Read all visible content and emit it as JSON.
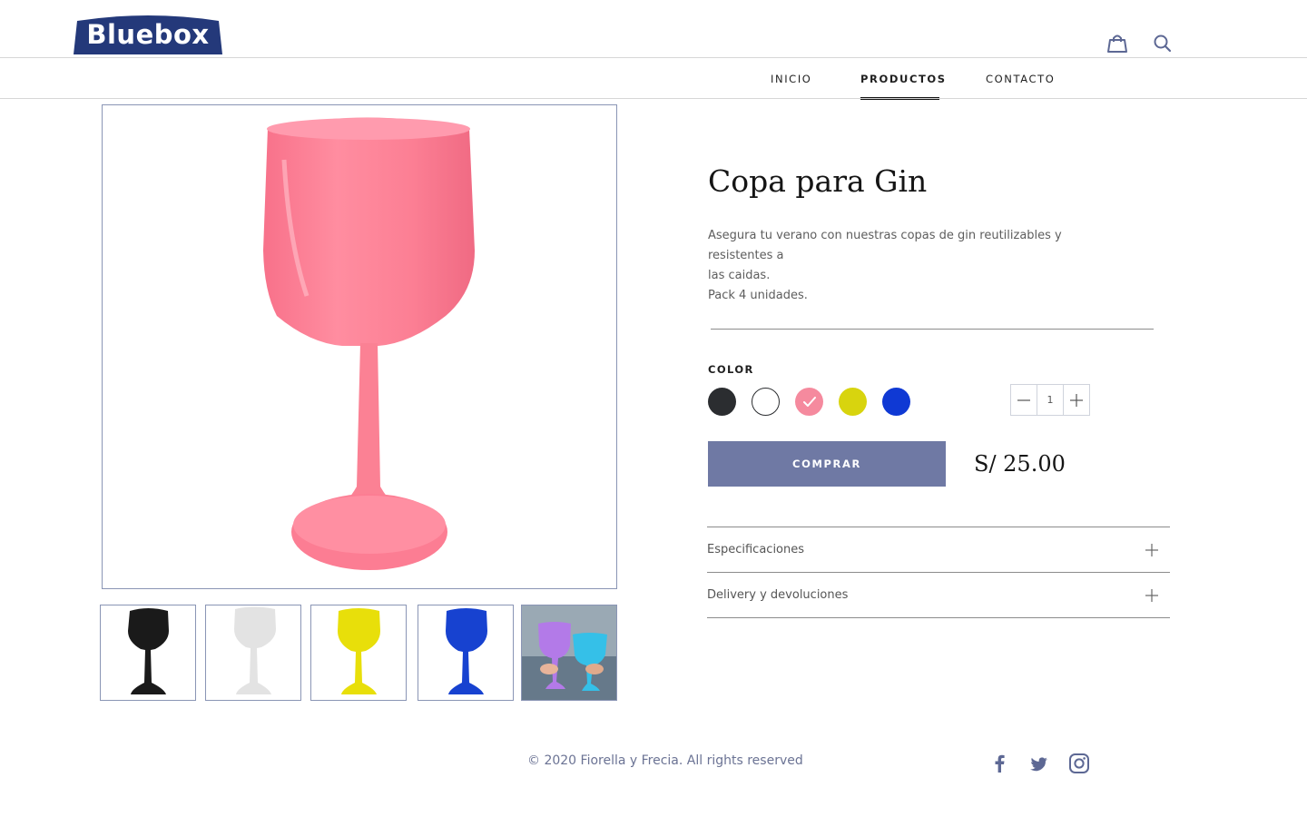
{
  "header": {
    "logo_text": "Bluebox",
    "brand_color": "#24397a",
    "icons": [
      "bag-icon",
      "search-icon"
    ]
  },
  "nav": {
    "items": [
      {
        "label": "INICIO",
        "active": false
      },
      {
        "label": "PRODUCTOS",
        "active": true
      },
      {
        "label": "CONTACTO",
        "active": false
      }
    ]
  },
  "product": {
    "title": "Copa para Gin",
    "description": [
      "Asegura tu verano con nuestras copas de gin reutilizables y resistentes a",
      "las caidas.",
      "Pack 4 unidades."
    ],
    "color_label": "COLOR",
    "colors": [
      {
        "name": "negro",
        "hex": "#2b2d30",
        "selected": false
      },
      {
        "name": "blanco",
        "hex": "#ffffff",
        "selected": false
      },
      {
        "name": "rosado",
        "hex": "#f58a9e",
        "selected": true
      },
      {
        "name": "amarillo",
        "hex": "#d8d40e",
        "selected": false
      },
      {
        "name": "azul",
        "hex": "#0f39d4",
        "selected": false
      }
    ],
    "quantity": "1",
    "buy_label": "COMPRAR",
    "price": "S/ 25.00",
    "accordion": [
      {
        "label": "Especificaciones",
        "icon": "plus-icon"
      },
      {
        "label": "Delivery y devoluciones",
        "icon": "plus-icon"
      }
    ],
    "thumbnails": [
      {
        "color": "#1a1a1a",
        "alt": "black glass"
      },
      {
        "color": "#ececec",
        "alt": "white glass"
      },
      {
        "color": "#e7de08",
        "alt": "yellow glass"
      },
      {
        "color": "#1a47d6",
        "alt": "blue glass"
      },
      {
        "color": "#b37ae8",
        "alt": "photo lifestyle"
      }
    ],
    "main_image_color": "#ff8a9c"
  },
  "footer": {
    "copyright": "© 2020 Fiorella y Frecia. All rights reserved",
    "social": [
      "facebook-icon",
      "twitter-icon",
      "instagram-icon"
    ]
  },
  "accent_color": "#6f79a4"
}
